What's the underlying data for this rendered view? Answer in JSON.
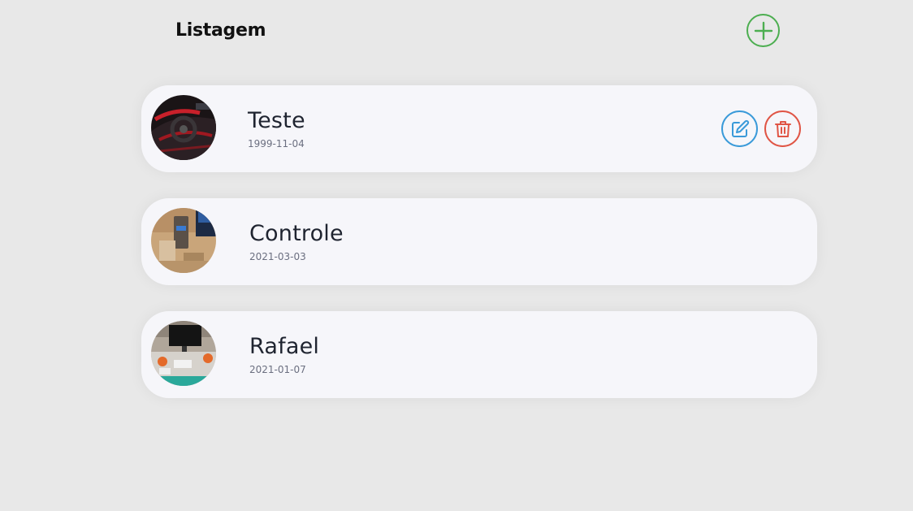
{
  "header": {
    "title": "Listagem",
    "add_icon": "plus-icon",
    "add_color": "#4cae50"
  },
  "items": [
    {
      "name": "Teste",
      "date": "1999-11-04",
      "avatar": "car-interior-photo",
      "actions": {
        "edit_icon": "edit-icon",
        "delete_icon": "trash-icon"
      }
    },
    {
      "name": "Controle",
      "date": "2021-03-03",
      "avatar": "desk-device-photo"
    },
    {
      "name": "Rafael",
      "date": "2021-01-07",
      "avatar": "workstation-photo"
    }
  ],
  "colors": {
    "background": "#e8e8e8",
    "card": "#f6f6fa",
    "edit": "#3a9ad9",
    "delete": "#e05545"
  }
}
